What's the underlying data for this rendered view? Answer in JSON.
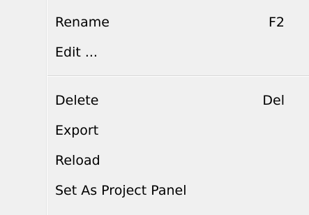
{
  "context_menu": {
    "items": [
      {
        "label": "Rename",
        "shortcut": "F2"
      },
      {
        "label": "Edit ...",
        "shortcut": ""
      },
      {
        "label": "Delete",
        "shortcut": "Del"
      },
      {
        "label": "Export",
        "shortcut": ""
      },
      {
        "label": "Reload",
        "shortcut": ""
      },
      {
        "label": "Set As Project Panel",
        "shortcut": ""
      }
    ]
  }
}
